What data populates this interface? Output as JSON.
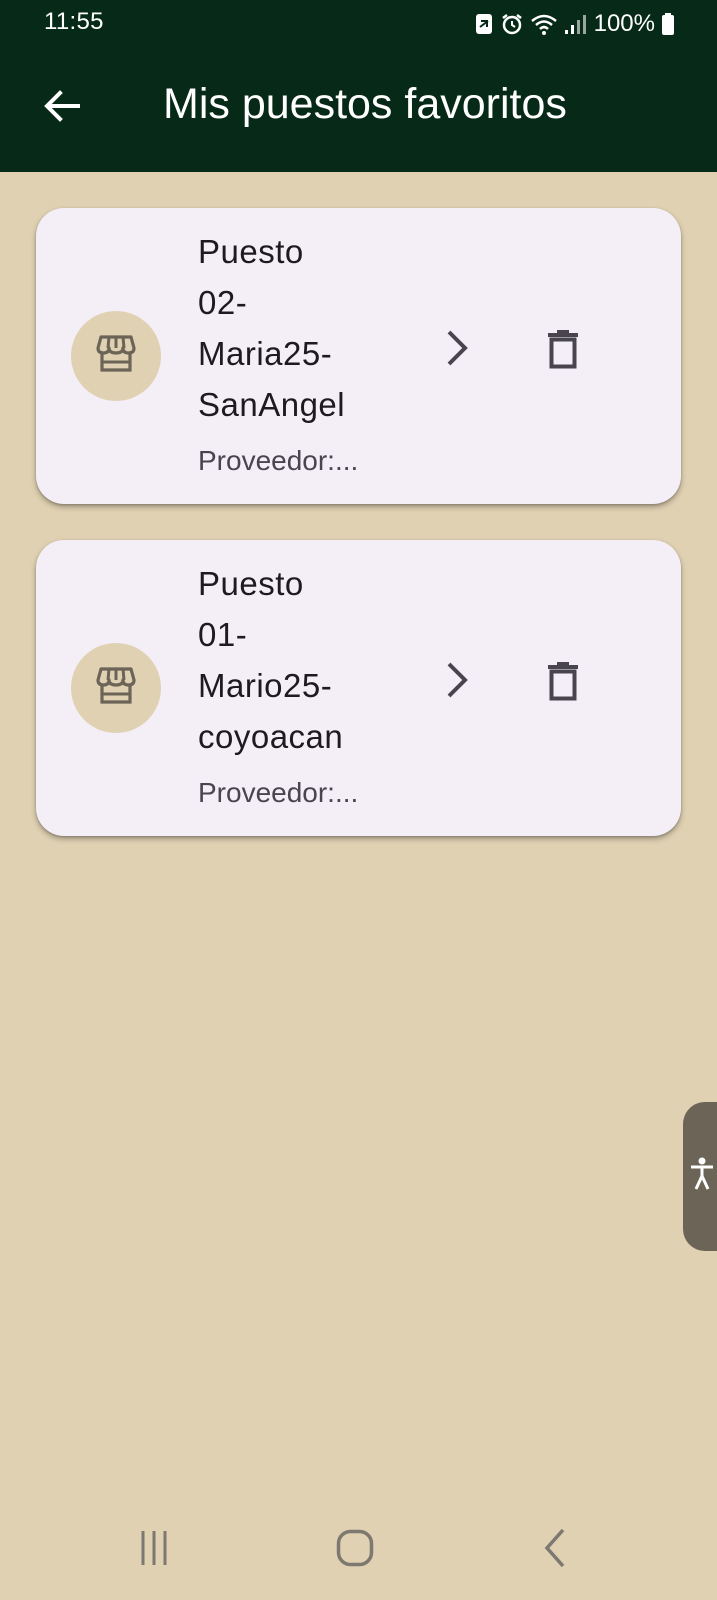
{
  "status_bar": {
    "time": "11:55",
    "battery": "100%",
    "icons": [
      "data-saver-icon",
      "alarm-icon",
      "wifi-icon",
      "signal-icon",
      "battery-icon"
    ]
  },
  "app_bar": {
    "title": "Mis puestos favoritos",
    "back_icon": "arrow-back-icon"
  },
  "favorites": [
    {
      "title_lines": [
        "Puesto",
        "02-",
        "Maria25-",
        "SanAngel"
      ],
      "subtitle": "Proveedor:..."
    },
    {
      "title_lines": [
        "Puesto",
        "01-",
        "Mario25-",
        "coyoacan"
      ],
      "subtitle": "Proveedor:..."
    }
  ],
  "colors": {
    "header_bg": "#072a18",
    "page_bg": "#e0d1b2",
    "card_bg": "#f4eff7",
    "avatar_bg": "#e0d1b2",
    "icon_color": "#49454f",
    "store_icon_color": "#6b6457"
  }
}
